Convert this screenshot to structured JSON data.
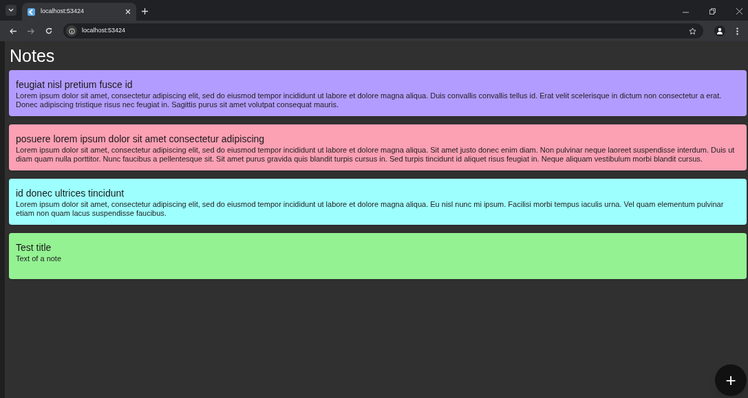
{
  "browser": {
    "tab_title": "localhost:53424",
    "address": "localhost:53424"
  },
  "title": "Notes",
  "notes": [
    {
      "title": "feugiat nisl pretium fusce id",
      "text": "Lorem ipsum dolor sit amet, consectetur adipiscing elit, sed do eiusmod tempor incididunt ut labore et dolore magna aliqua. Duis convallis convallis tellus id. Erat velit scelerisque in dictum non consectetur a erat. Donec adipiscing tristique risus nec feugiat in. Sagittis purus sit amet volutpat consequat mauris.",
      "color": "#b39cff"
    },
    {
      "title": "posuere lorem ipsum dolor sit amet consectetur adipiscing",
      "text": "Lorem ipsum dolor sit amet, consectetur adipiscing elit, sed do eiusmod tempor incididunt ut labore et dolore magna aliqua. Sit amet justo donec enim diam. Non pulvinar neque laoreet suspendisse interdum. Duis ut diam quam nulla porttitor. Nunc faucibus a pellentesque sit. Sit amet purus gravida quis blandit turpis cursus in. Sed turpis tincidunt id aliquet risus feugiat in. Neque aliquam vestibulum morbi blandit cursus.",
      "color": "#fca0b4"
    },
    {
      "title": "id donec ultrices tincidunt",
      "text": "Lorem ipsum dolor sit amet, consectetur adipiscing elit, sed do eiusmod tempor incididunt ut labore et dolore magna aliqua. Eu nisl nunc mi ipsum. Facilisi morbi tempus iaculis urna. Vel quam elementum pulvinar etiam non quam lacus suspendisse faucibus.",
      "color": "#9effff"
    },
    {
      "title": "Test title",
      "text": "Text of a note",
      "color": "#94f293"
    }
  ],
  "fab": "+"
}
